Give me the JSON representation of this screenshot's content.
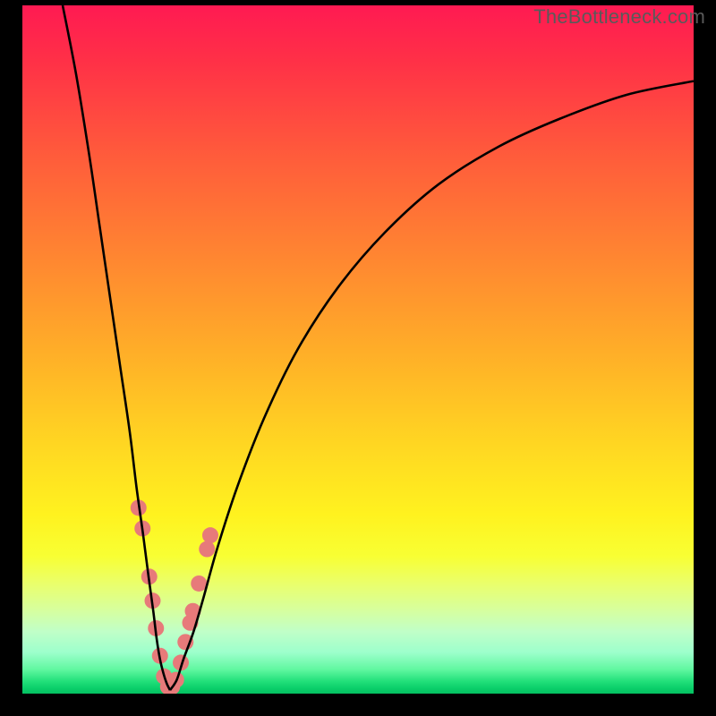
{
  "watermark": "TheBottleneck.com",
  "chart_data": {
    "type": "line",
    "title": "",
    "xlabel": "",
    "ylabel": "",
    "xlim": [
      0,
      100
    ],
    "ylim": [
      0,
      100
    ],
    "grid": false,
    "legend": false,
    "gradient_stops": [
      {
        "pos": 0,
        "color": "#ff1a52"
      },
      {
        "pos": 0.22,
        "color": "#ff5c3b"
      },
      {
        "pos": 0.52,
        "color": "#ffb327"
      },
      {
        "pos": 0.74,
        "color": "#fff21f"
      },
      {
        "pos": 0.88,
        "color": "#d6ffa0"
      },
      {
        "pos": 0.97,
        "color": "#22e07a"
      },
      {
        "pos": 1.0,
        "color": "#05c061"
      }
    ],
    "series": [
      {
        "name": "left-curve",
        "color": "#000000",
        "x": [
          6,
          8,
          10,
          11.5,
          13,
          14.5,
          16,
          17,
          18,
          18.8,
          19.5,
          20,
          20.5,
          21,
          21.5,
          22
        ],
        "y": [
          100,
          90,
          78,
          68,
          58,
          48,
          38,
          30,
          23,
          17,
          12,
          8,
          5,
          3,
          1.5,
          0.5
        ]
      },
      {
        "name": "right-curve",
        "color": "#000000",
        "x": [
          22,
          23,
          24,
          25.5,
          27,
          29,
          32,
          36,
          41,
          47,
          54,
          62,
          71,
          80,
          90,
          100
        ],
        "y": [
          0.5,
          2,
          5,
          9,
          14,
          21,
          30,
          40,
          50,
          59,
          67,
          74,
          79.5,
          83.5,
          87,
          89
        ]
      }
    ],
    "scatter": {
      "name": "highlight-dots",
      "color": "#e77a7a",
      "radius": 9,
      "points": [
        {
          "x": 17.3,
          "y": 27
        },
        {
          "x": 17.9,
          "y": 24
        },
        {
          "x": 18.9,
          "y": 17
        },
        {
          "x": 19.4,
          "y": 13.5
        },
        {
          "x": 19.9,
          "y": 9.5
        },
        {
          "x": 20.5,
          "y": 5.5
        },
        {
          "x": 21.1,
          "y": 2.5
        },
        {
          "x": 21.7,
          "y": 1.0
        },
        {
          "x": 22.3,
          "y": 1.0
        },
        {
          "x": 22.9,
          "y": 2.0
        },
        {
          "x": 23.6,
          "y": 4.5
        },
        {
          "x": 24.3,
          "y": 7.5
        },
        {
          "x": 25.0,
          "y": 10.3
        },
        {
          "x": 25.4,
          "y": 12.0
        },
        {
          "x": 26.3,
          "y": 16.0
        },
        {
          "x": 27.5,
          "y": 21.0
        },
        {
          "x": 28.0,
          "y": 23.0
        }
      ]
    }
  }
}
